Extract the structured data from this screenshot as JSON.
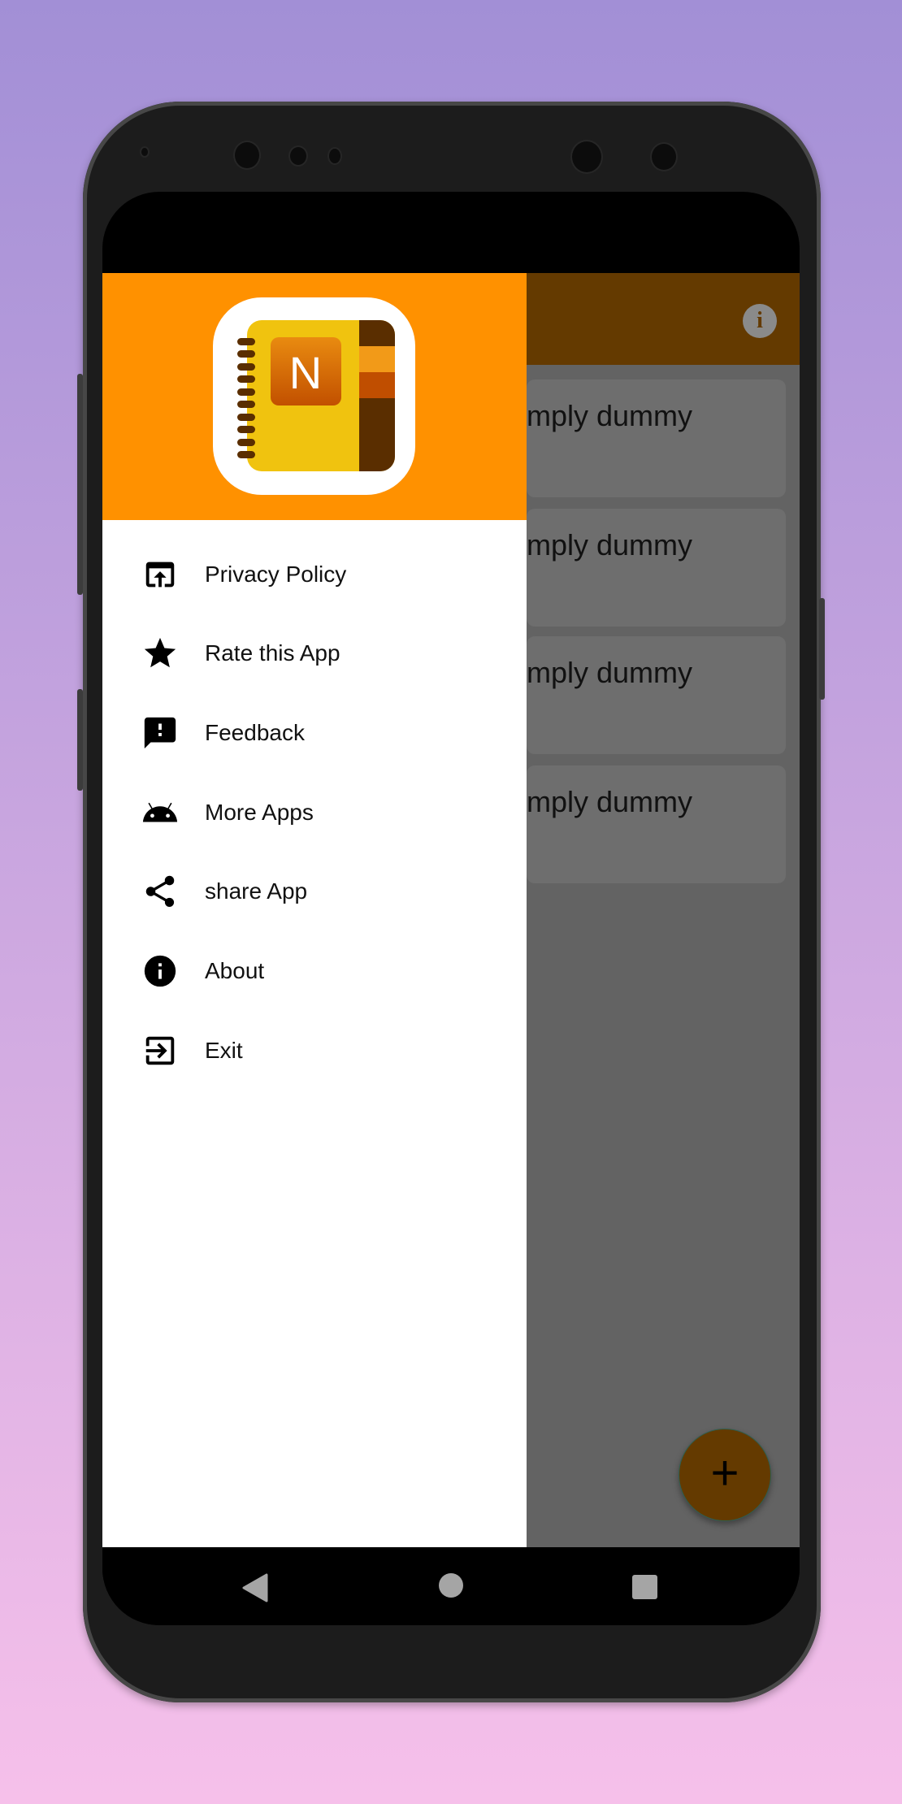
{
  "app_bar": {
    "info_icon": "info-icon",
    "color": "#643a00"
  },
  "drawer": {
    "header_color": "#ff9100",
    "logo_letter": "N",
    "items": [
      {
        "label": "Privacy Policy",
        "icon": "open-in-browser-icon"
      },
      {
        "label": "Rate this App",
        "icon": "star-icon"
      },
      {
        "label": "Feedback",
        "icon": "feedback-icon"
      },
      {
        "label": "More Apps",
        "icon": "android-icon"
      },
      {
        "label": "share App",
        "icon": "share-icon"
      },
      {
        "label": "About",
        "icon": "info-icon"
      },
      {
        "label": "Exit",
        "icon": "exit-icon"
      }
    ]
  },
  "notes": [
    {
      "text": "mply dummy"
    },
    {
      "text": "mply dummy"
    },
    {
      "text": "mply dummy"
    },
    {
      "text": "mply dummy"
    }
  ],
  "fab": {
    "label": "+"
  },
  "navbar": {
    "back": "back-icon",
    "home": "home-icon",
    "recents": "recents-icon"
  }
}
